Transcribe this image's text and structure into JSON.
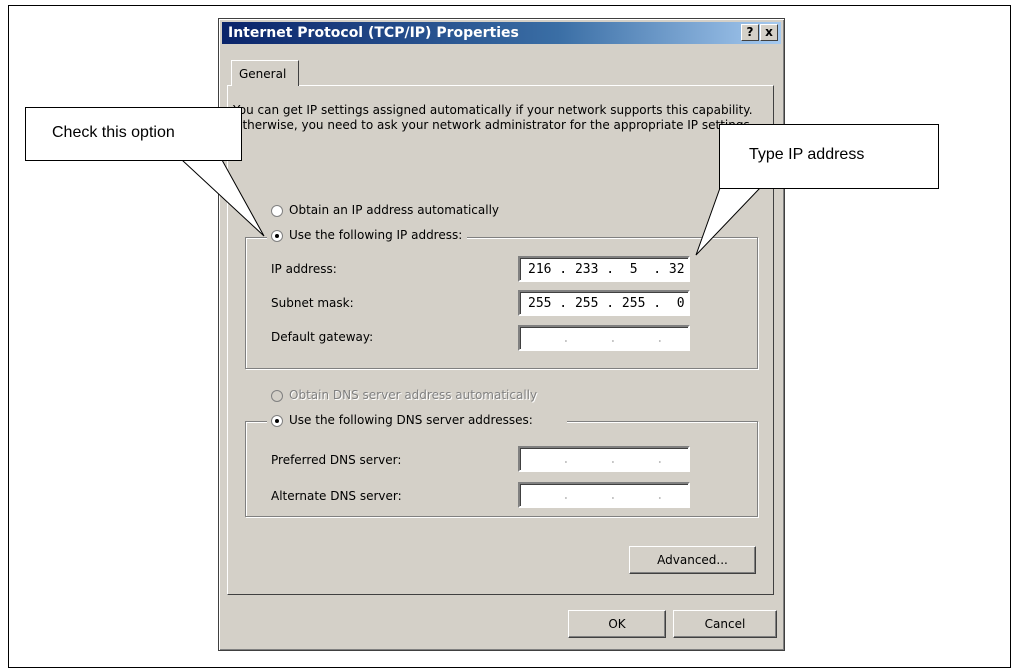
{
  "dialog": {
    "title": "Internet Protocol (TCP/IP) Properties",
    "help_button": "?",
    "close_button": "x",
    "tab_general": "General",
    "intro_text": "You can get IP settings assigned automatically if your network supports this capability. Otherwise, you need to ask your network administrator for the appropriate IP settings.",
    "radio_obtain_ip": "Obtain an IP address automatically",
    "radio_use_ip": "Use the following IP address:",
    "ip_label": "IP address:",
    "ip_value": "216 . 233 .  5  . 32",
    "subnet_label": "Subnet mask:",
    "subnet_value": "255 . 255 . 255 .  0",
    "gateway_label": "Default gateway:",
    "gateway_value": ".     .     .",
    "radio_obtain_dns": "Obtain DNS server address automatically",
    "radio_use_dns": "Use the following DNS server addresses:",
    "preferred_dns_label": "Preferred DNS server:",
    "preferred_dns_value": ".     .     .",
    "alternate_dns_label": "Alternate DNS server:",
    "alternate_dns_value": ".     .     .",
    "advanced_button": "Advanced...",
    "ok_button": "OK",
    "cancel_button": "Cancel"
  },
  "callouts": {
    "check_option": "Check this option",
    "type_ip": "Type IP address"
  },
  "colors": {
    "dialog_bg": "#d4d0c8",
    "titlebar": "#0a246a"
  }
}
